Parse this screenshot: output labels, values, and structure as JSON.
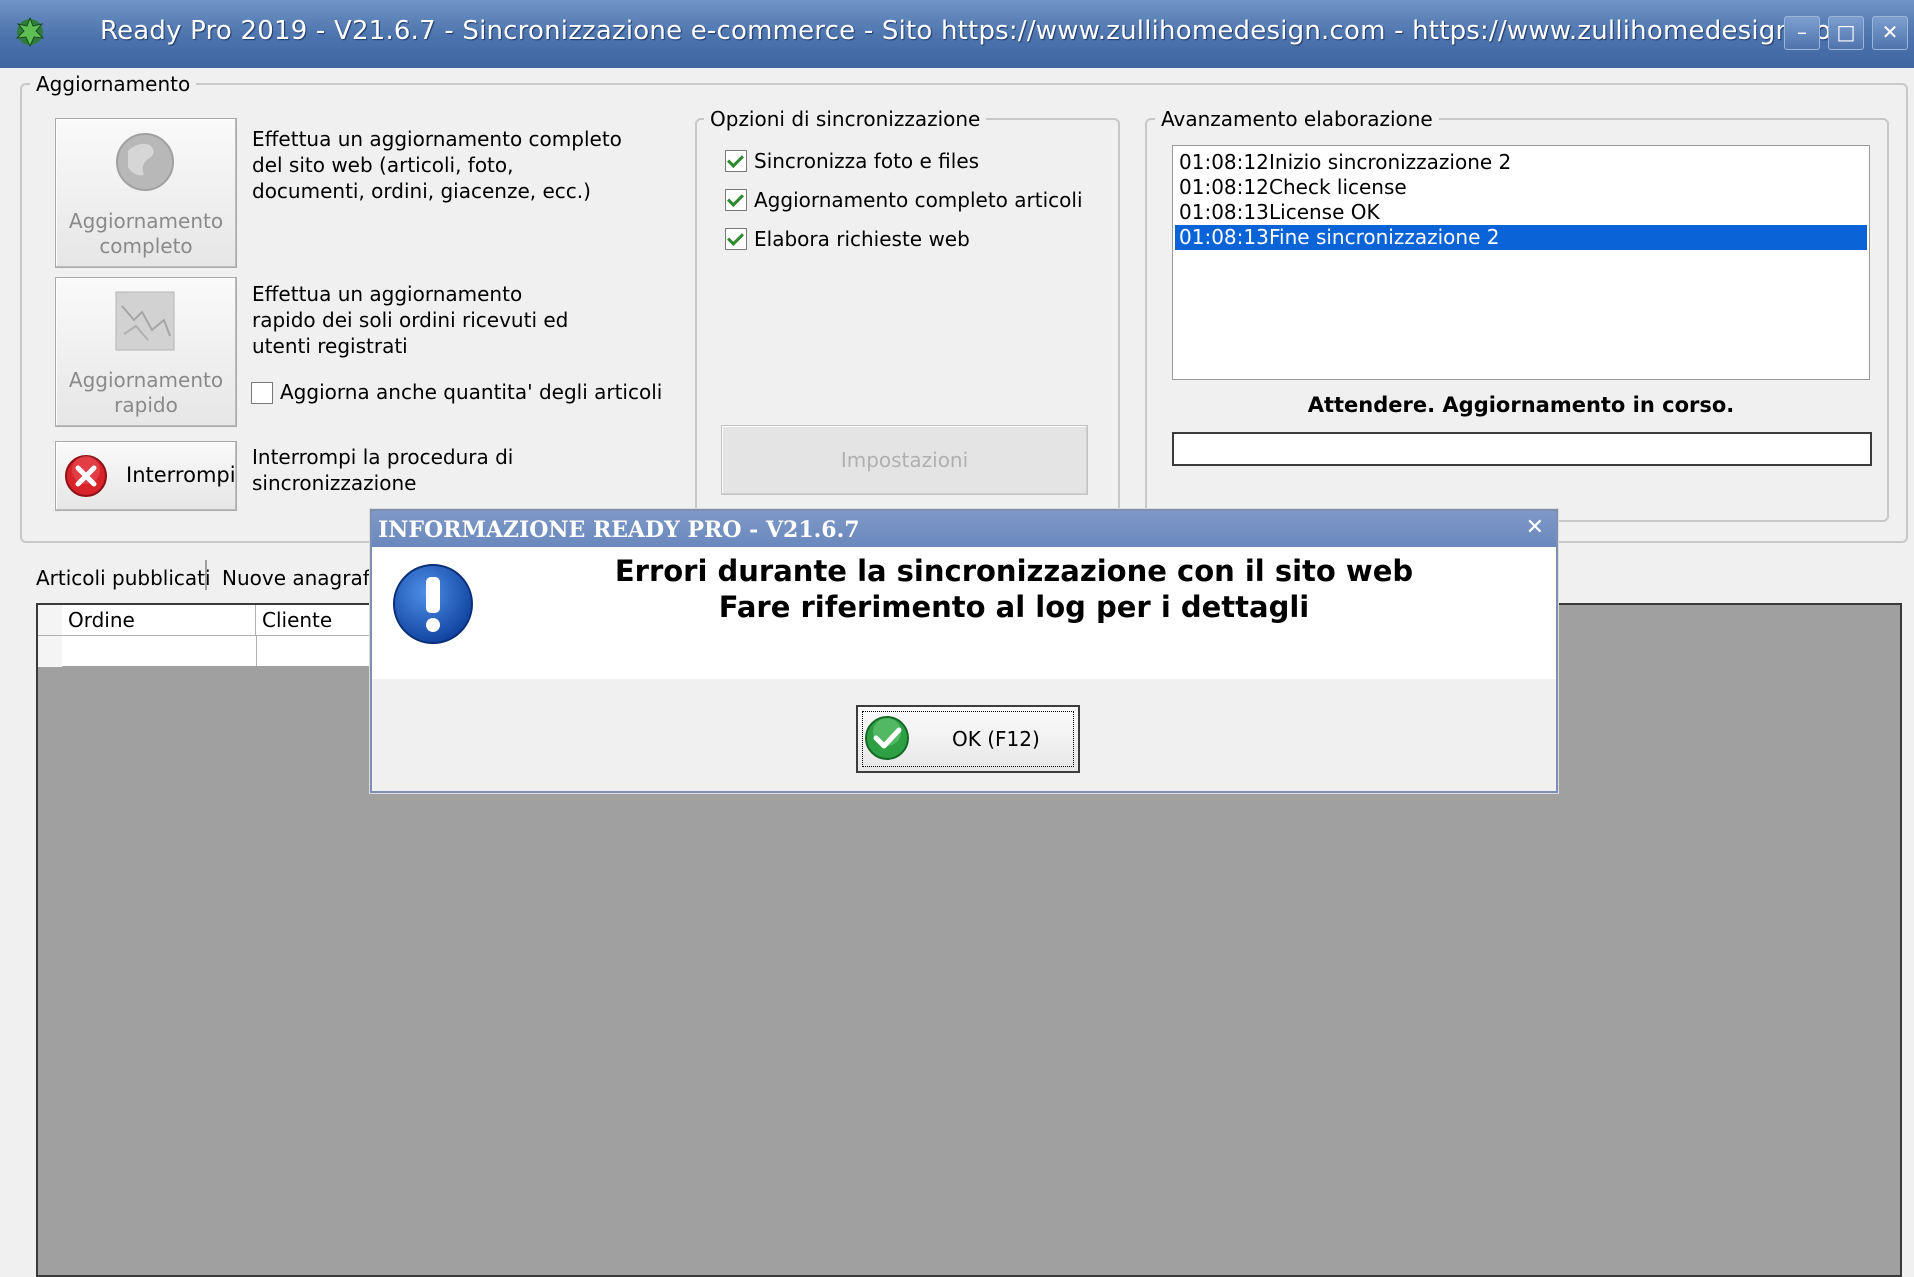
{
  "window": {
    "title": "Ready Pro 2019 - V21.6.7 - Sincronizzazione e-commerce - Sito https://www.zullihomedesign.com - https://www.zullihomedesign.com",
    "minimize": "–",
    "maximize": "□",
    "close": "✕"
  },
  "aggiornamento": {
    "group_label": "Aggiornamento",
    "completo": {
      "label_line1": "Aggiornamento",
      "label_line2": "completo",
      "desc_line1": "Effettua un aggiornamento completo",
      "desc_line2": "del sito web (articoli, foto,",
      "desc_line3": "documenti, ordini, giacenze, ecc.)"
    },
    "rapido": {
      "label_line1": "Aggiornamento",
      "label_line2": "rapido",
      "desc_line1": "Effettua un aggiornamento",
      "desc_line2": "rapido dei soli ordini ricevuti ed",
      "desc_line3": "utenti registrati"
    },
    "quantita_checkbox": {
      "label": "Aggiorna anche quantita' degli articoli",
      "checked": false
    },
    "interrompi": {
      "label": "Interrompi",
      "desc_line1": "Interrompi la procedura di",
      "desc_line2": "sincronizzazione"
    }
  },
  "opzioni": {
    "group_label": "Opzioni di sincronizzazione",
    "items": [
      {
        "label": "Sincronizza foto e files",
        "checked": true
      },
      {
        "label": "Aggiornamento completo articoli",
        "checked": true
      },
      {
        "label": "Elabora richieste web",
        "checked": true
      }
    ],
    "impostazioni_label": "Impostazioni"
  },
  "avanzamento": {
    "group_label": "Avanzamento elaborazione",
    "log": [
      {
        "time": "01:08:12",
        "text": "Inizio sincronizzazione 2",
        "selected": false
      },
      {
        "time": "01:08:12",
        "text": "Check license",
        "selected": false
      },
      {
        "time": "01:08:13",
        "text": "License OK",
        "selected": false
      },
      {
        "time": "01:08:13",
        "text": "Fine sincronizzazione 2",
        "selected": true
      }
    ],
    "status": "Attendere. Aggiornamento in corso.",
    "progress": 0
  },
  "tabs": [
    "Articoli pubblicati",
    "Nuove anagrafi"
  ],
  "grid": {
    "columns": [
      "Ordine",
      "Cliente"
    ]
  },
  "dialog": {
    "title": "INFORMAZIONE READY PRO - V21.6.7",
    "close": "✕",
    "message_line1": "Errori durante la sincronizzazione con il sito web",
    "message_line2": "Fare riferimento al log per i dettagli",
    "ok_label": "OK (F12)"
  },
  "colors": {
    "title_bar": "#4c73ad",
    "selection": "#0a64d8",
    "grid_bg": "#a0a0a0",
    "dialog_title": "#7390c2"
  }
}
